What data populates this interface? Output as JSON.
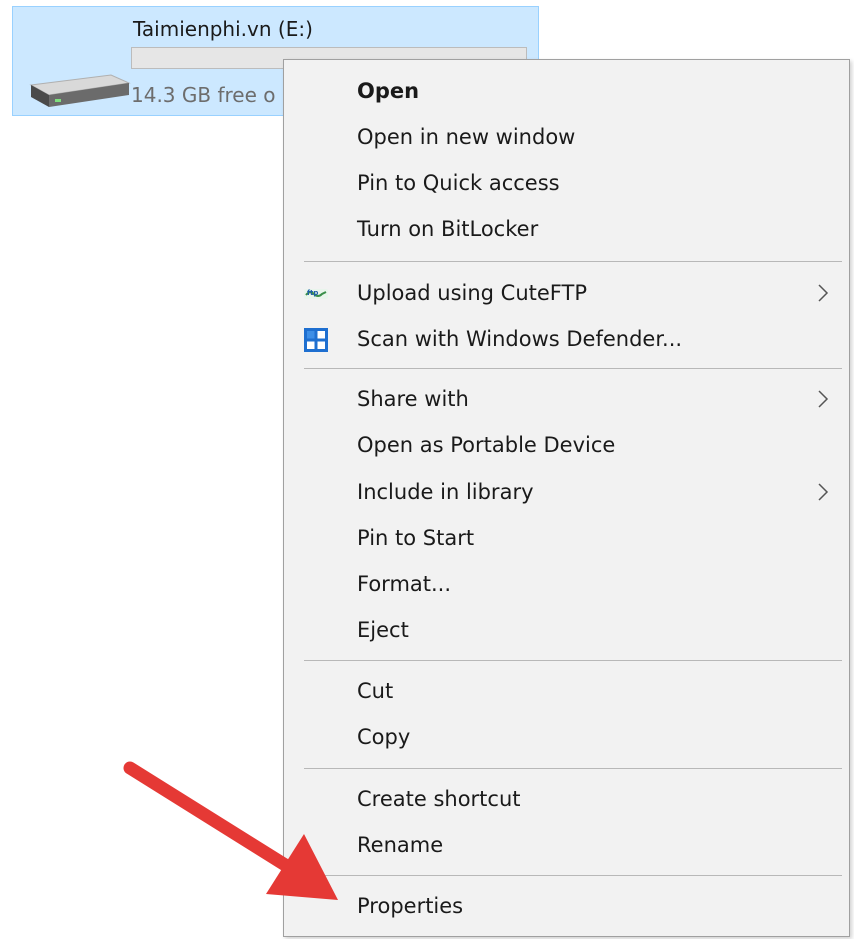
{
  "drive": {
    "name": "Taimienphi.vn (E:)",
    "free_text": "14.3 GB free o",
    "used_fraction": 0.0,
    "icon": "drive-icon"
  },
  "context_menu": {
    "items": [
      {
        "label": "Open",
        "bold": true
      },
      {
        "label": "Open in new window"
      },
      {
        "label": "Pin to Quick access"
      },
      {
        "label": "Turn on BitLocker"
      },
      {
        "label": "Upload using CuteFTP",
        "icon": "cuteftp-icon",
        "submenu": true
      },
      {
        "label": "Scan with Windows Defender...",
        "icon": "windows-defender-icon"
      },
      {
        "label": "Share with",
        "submenu": true
      },
      {
        "label": "Open as Portable Device"
      },
      {
        "label": "Include in library",
        "submenu": true
      },
      {
        "label": "Pin to Start"
      },
      {
        "label": "Format..."
      },
      {
        "label": "Eject"
      },
      {
        "label": "Cut"
      },
      {
        "label": "Copy"
      },
      {
        "label": "Create shortcut"
      },
      {
        "label": "Rename"
      },
      {
        "label": "Properties"
      }
    ]
  },
  "annotation": {
    "icon": "red-arrow-icon",
    "color": "#e53935"
  }
}
